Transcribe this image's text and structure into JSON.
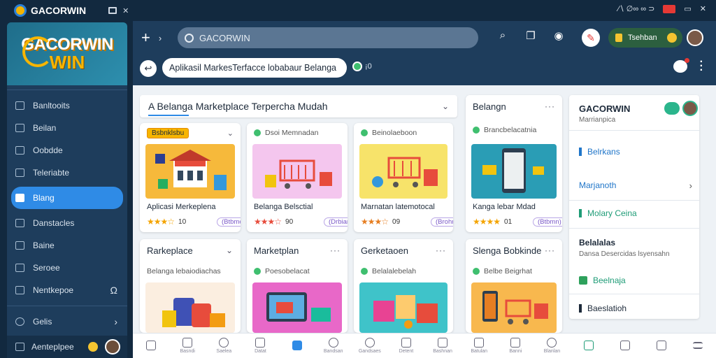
{
  "titlebar": {
    "app_name": "GACORWIN",
    "right_text": "∕∖  ∅∞  ∞ ⊃"
  },
  "sidebar": {
    "banner_line1": "GACORWIN",
    "banner_line2": "WIN",
    "items": [
      {
        "label": "Banltooits",
        "icon": "grid-icon"
      },
      {
        "label": "Beilan",
        "icon": "folder-icon"
      },
      {
        "label": "Oobdde",
        "icon": "document-icon"
      },
      {
        "label": "Teleriabte",
        "icon": "list-icon"
      },
      {
        "label": "Blang",
        "icon": "shopping-bag-icon",
        "active": true
      },
      {
        "label": "Danstacles",
        "icon": "tag-icon"
      },
      {
        "label": "Baine",
        "icon": "box-icon"
      },
      {
        "label": "Seroee",
        "icon": "settings-icon"
      },
      {
        "label": "Nentkepoe",
        "icon": "store-icon"
      },
      {
        "label": "Gelis",
        "icon": "gear-icon"
      }
    ],
    "footer_label": "Aenteplpee"
  },
  "topbar": {
    "search_text": "GACORWIN",
    "status_label": "Tsehban"
  },
  "address": {
    "url_text": "Aplikasil MarkesTerfacce lobabaur Belanga",
    "badge_text": "¡0"
  },
  "content": {
    "heading": "A Belanga Marketplace Terpercha Mudah",
    "cards_row1": [
      {
        "tag": "Bsbnklsbu",
        "caption": "Aplicasi Merkeplena",
        "rating": "★★★☆",
        "count": "10",
        "pill": "(Btbmo)"
      },
      {
        "sub": "Dsoi Memnadan",
        "caption": "Belanga Belsctial",
        "rating": "★★★☆",
        "count": "90",
        "pill": "(Drbian)"
      },
      {
        "sub": "Beinolaeboon",
        "caption": "Marnatan latemotocal",
        "rating": "★★★☆",
        "count": "09",
        "pill": "(Brohm)"
      },
      {
        "title": "Belangn",
        "sub": "Brancbelacatnia",
        "caption": "Kanga lebar Mdad",
        "rating": "★★★★",
        "count": "01",
        "pill": "(Btbmn)"
      }
    ],
    "cards_row2": [
      {
        "title": "Rarkeplace",
        "sub": "Belanga lebaiodiachas"
      },
      {
        "title": "Marketplan",
        "sub": "Poesobelacat"
      },
      {
        "title": "Gerketaoen",
        "sub": "Belalalebelah"
      },
      {
        "title": "Slenga Bobkinde",
        "sub": "Belbe Beigrhat"
      }
    ]
  },
  "rpanel": {
    "title": "GACORWIN",
    "subtitle": "Marrianpica",
    "link1": "Belrkans",
    "link2": "Marjanoth",
    "link3": "Molary Ceina",
    "bold": "Belalalas",
    "bold_sub": "Dansa Desercidas lsyensahn",
    "link4": "Beelnaja",
    "link5": "Baeslatioh"
  },
  "bottomnav": [
    {
      "label": "",
      "icon": "home-icon"
    },
    {
      "label": "Basndi",
      "icon": "heart-icon"
    },
    {
      "label": "Saelea",
      "icon": "search-icon"
    },
    {
      "label": "Datat",
      "icon": "news-icon"
    },
    {
      "label": "",
      "icon": "shopping-bag-icon",
      "active": true
    },
    {
      "label": "Bandsan",
      "icon": "chat-icon"
    },
    {
      "label": "Gandsaes",
      "icon": "user-icon"
    },
    {
      "label": "Detent",
      "icon": "gift-icon"
    },
    {
      "label": "Bashnan",
      "icon": "bell-icon"
    },
    {
      "label": "Batulan",
      "icon": "tag-icon"
    },
    {
      "label": "Banni",
      "icon": "receipt-icon"
    },
    {
      "label": "Blanlan",
      "icon": "clock-icon"
    },
    {
      "label": "",
      "icon": "bookmark-icon"
    },
    {
      "label": "",
      "icon": "box-icon"
    },
    {
      "label": "",
      "icon": "document-icon"
    },
    {
      "label": "",
      "icon": "menu-icon"
    }
  ]
}
